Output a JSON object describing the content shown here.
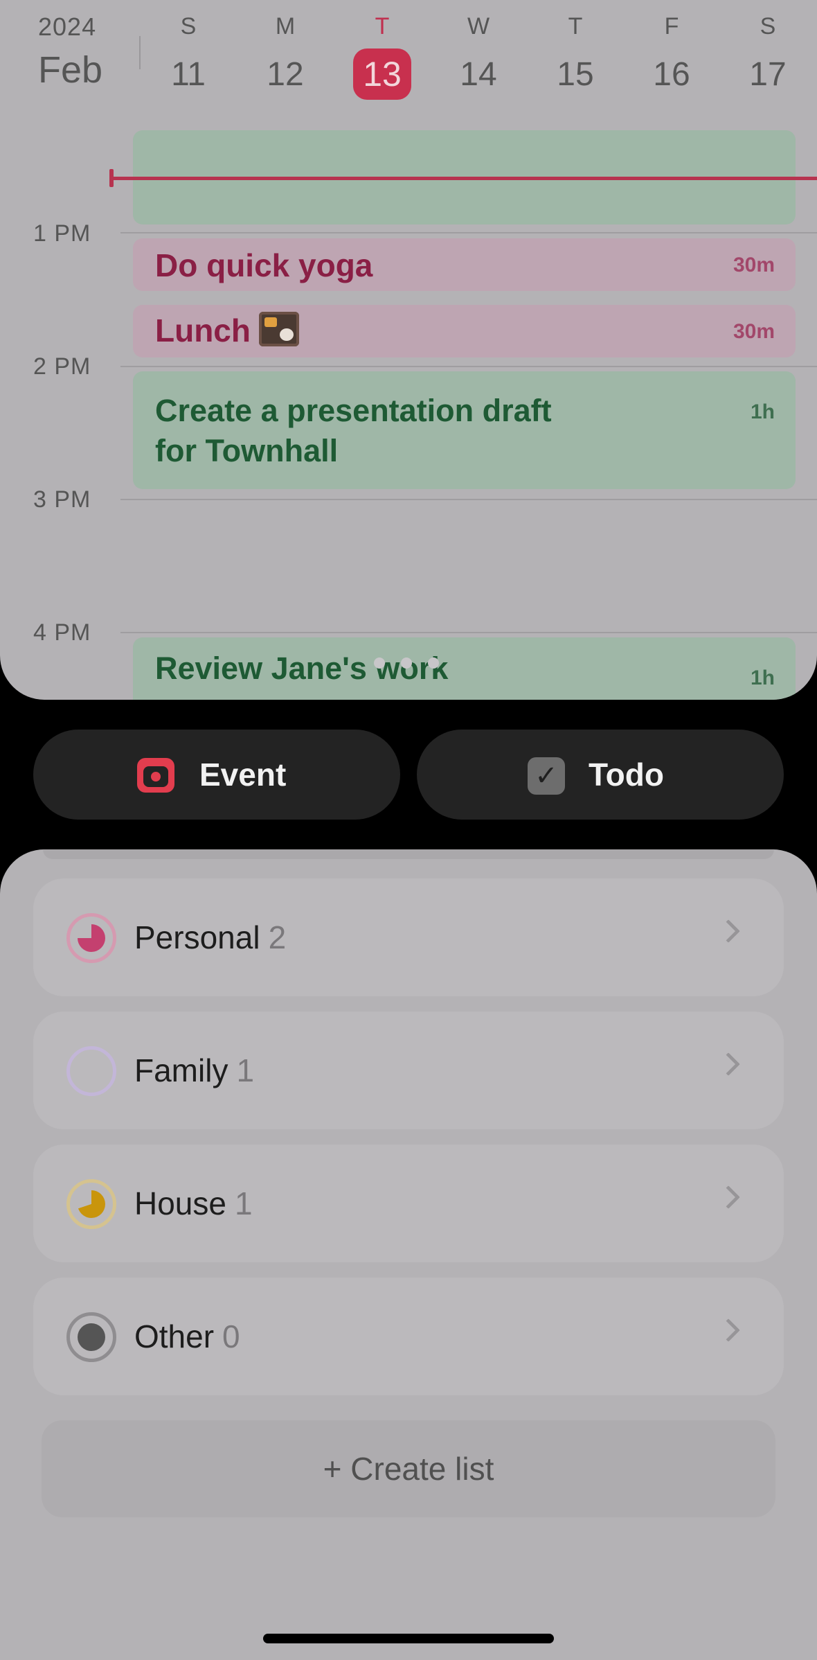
{
  "header": {
    "year": "2024",
    "month": "Feb",
    "days": [
      {
        "letter": "S",
        "num": "11",
        "today": false
      },
      {
        "letter": "M",
        "num": "12",
        "today": false
      },
      {
        "letter": "T",
        "num": "13",
        "today": true
      },
      {
        "letter": "W",
        "num": "14",
        "today": false
      },
      {
        "letter": "T",
        "num": "15",
        "today": false
      },
      {
        "letter": "F",
        "num": "16",
        "today": false
      },
      {
        "letter": "S",
        "num": "17",
        "today": false
      }
    ]
  },
  "timeline": {
    "hours": [
      "1 PM",
      "2 PM",
      "3 PM",
      "4 PM"
    ],
    "events": [
      {
        "title": "Do quick yoga",
        "duration": "30m",
        "color": "pink"
      },
      {
        "title": "Lunch",
        "emoji": "bento-box",
        "duration": "30m",
        "color": "pink"
      },
      {
        "title_line1": "Create a presentation draft",
        "title_line2": "for Townhall",
        "duration": "1h",
        "color": "green"
      },
      {
        "title": "Review Jane's work",
        "duration": "1h",
        "color": "green"
      }
    ]
  },
  "actions": {
    "event_label": "Event",
    "todo_label": "Todo"
  },
  "lists": [
    {
      "name": "Personal",
      "count": "2",
      "color": "#c4406f"
    },
    {
      "name": "Family",
      "count": "1",
      "color": "#b7a5cf"
    },
    {
      "name": "House",
      "count": "1",
      "color": "#c9950c"
    },
    {
      "name": "Other",
      "count": "0",
      "color": "#555555"
    }
  ],
  "create_list_label": "+ Create list",
  "colors": {
    "today_accent": "#c8304e",
    "now_line": "#b7334f",
    "event_icon": "#e23d4e"
  }
}
